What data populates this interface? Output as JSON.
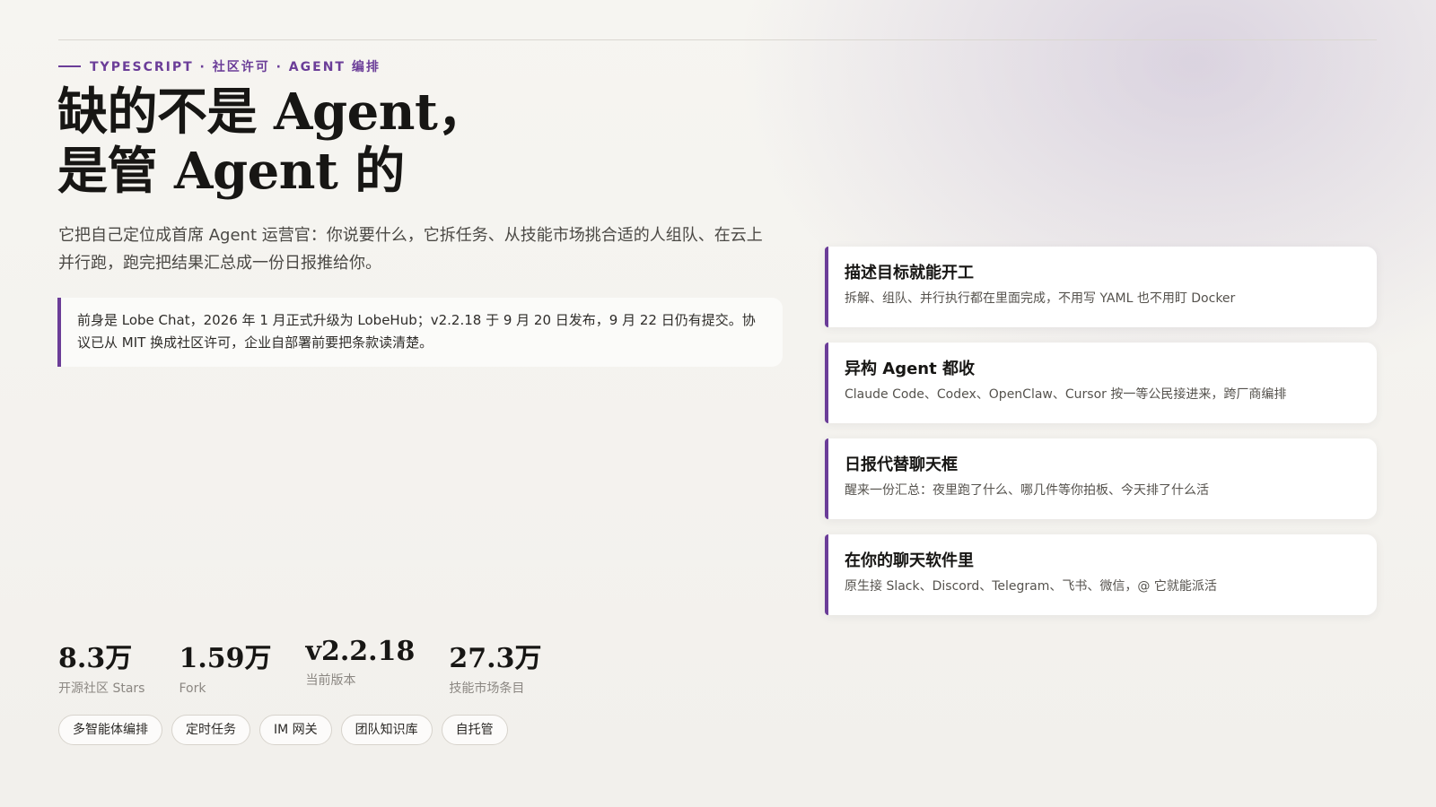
{
  "kicker": "TYPESCRIPT · 社区许可 · AGENT 编排",
  "headline": {
    "line1": "缺的不是 Agent，",
    "line2": "是管 Agent 的"
  },
  "lede": "它把自己定位成首席 Agent 运营官：你说要什么，它拆任务、从技能市场挑合适的人组队、在云上并行跑，跑完把结果汇总成一份日报推给你。",
  "note": "前身是 Lobe Chat，2026 年 1 月正式升级为 LobeHub；v2.2.18 于 9 月 20 日发布，9 月 22 日仍有提交。协议已从 MIT 换成社区许可，企业自部署前要把条款读清楚。",
  "features": [
    {
      "title": "描述目标就能开工",
      "desc": "拆解、组队、并行执行都在里面完成，不用写 YAML 也不用盯 Docker"
    },
    {
      "title": "异构 Agent 都收",
      "desc": "Claude Code、Codex、OpenClaw、Cursor 按一等公民接进来，跨厂商编排"
    },
    {
      "title": "日报代替聊天框",
      "desc": "醒来一份汇总：夜里跑了什么、哪几件等你拍板、今天排了什么活"
    },
    {
      "title": "在你的聊天软件里",
      "desc": "原生接 Slack、Discord、Telegram、飞书、微信，@ 它就能派活"
    }
  ],
  "stats": [
    {
      "value": "8.3万",
      "label": "开源社区 Stars"
    },
    {
      "value": "1.59万",
      "label": "Fork"
    },
    {
      "value": "v2.2.18",
      "label": "当前版本"
    },
    {
      "value": "27.3万",
      "label": "技能市场条目"
    }
  ],
  "tags": [
    "多智能体编排",
    "定时任务",
    "IM 网关",
    "团队知识库",
    "自托管"
  ],
  "colors": {
    "accent": "#6b3d98",
    "text": "#171614",
    "muted": "#8b8782",
    "background": "#f4f2ee"
  }
}
